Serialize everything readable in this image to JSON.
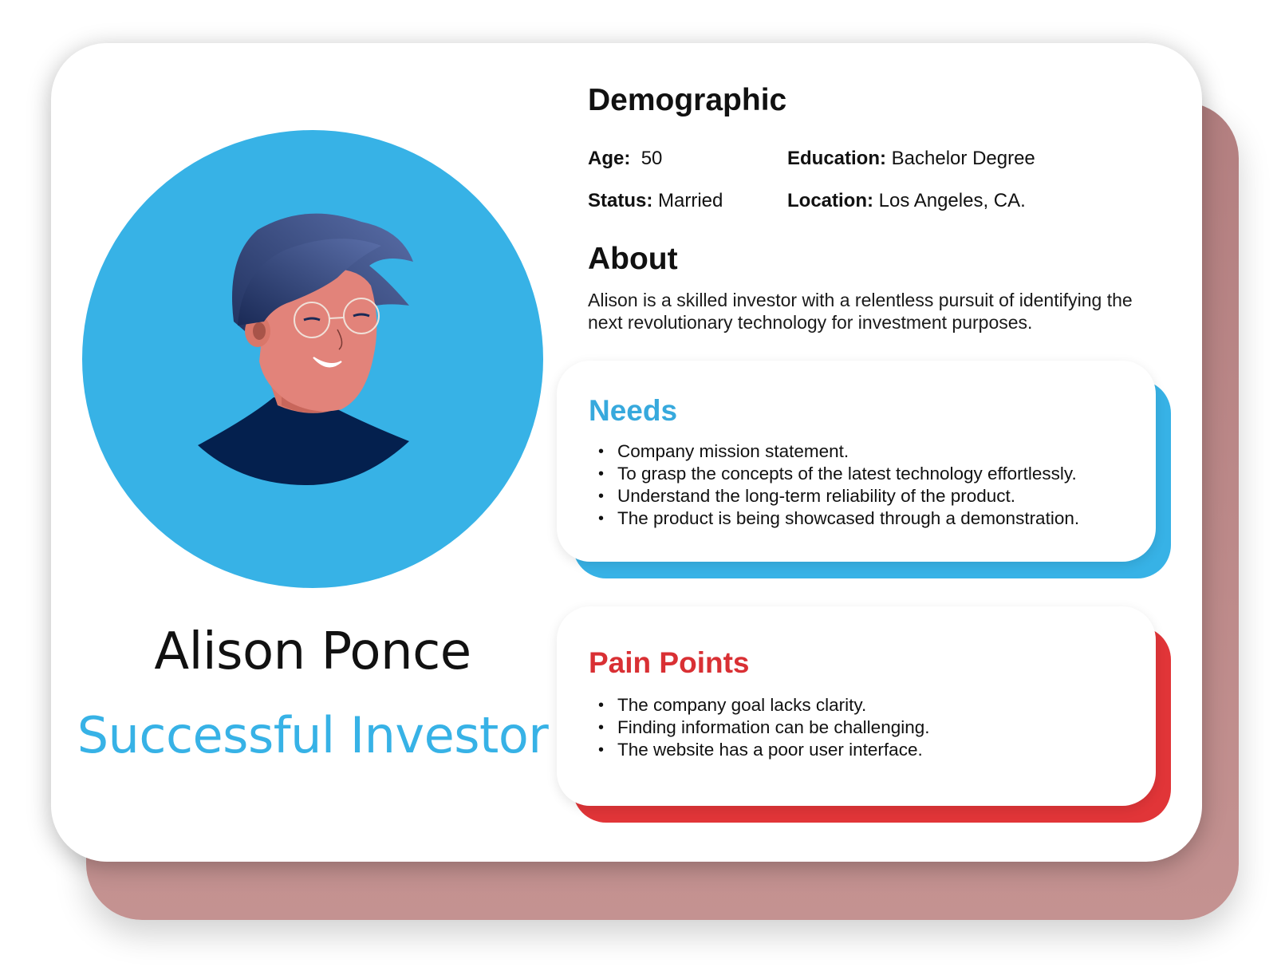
{
  "persona": {
    "name": "Alison Ponce",
    "role": "Successful Investor",
    "avatar_icon": "person-avatar-icon"
  },
  "demographic": {
    "title": "Demographic",
    "age_label": "Age:",
    "age_value": "50",
    "education_label": "Education:",
    "education_value": "Bachelor Degree",
    "status_label": "Status:",
    "status_value": "Married",
    "location_label": "Location:",
    "location_value": "Los Angeles, CA."
  },
  "about": {
    "title": "About",
    "text": "Alison is a skilled investor with a relentless pursuit of identifying the next revolutionary technology for investment purposes."
  },
  "needs": {
    "title": "Needs",
    "items": [
      "Company mission statement.",
      "To grasp the concepts of the latest technology effortlessly.",
      "Understand the long-term reliability of the product.",
      "The product is being showcased through a demonstration."
    ]
  },
  "pain_points": {
    "title": "Pain Points",
    "items": [
      "The company goal lacks clarity.",
      "Finding information can be challenging.",
      "The website has a poor user interface."
    ]
  },
  "colors": {
    "accent_blue": "#37b2e6",
    "accent_red": "#e13538",
    "back_card": "#b37f80"
  }
}
